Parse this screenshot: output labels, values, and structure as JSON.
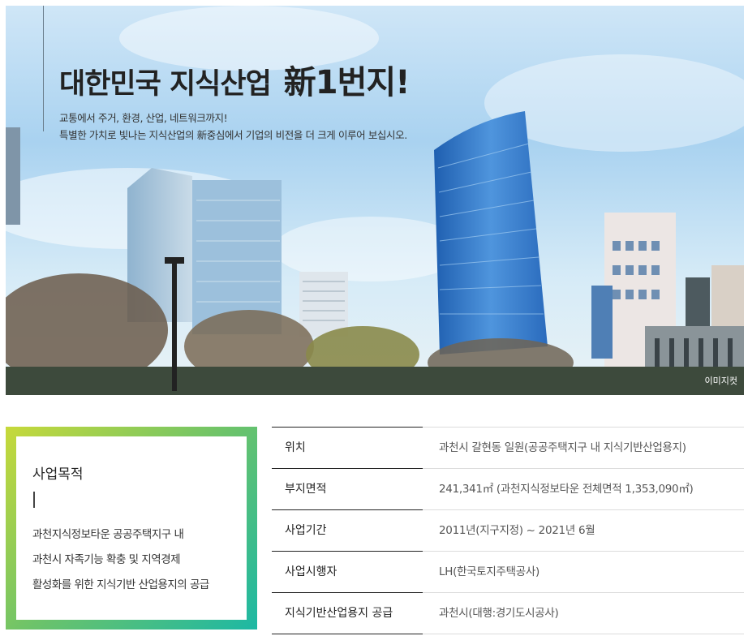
{
  "hero": {
    "title_main": "대한민국 지식산업",
    "title_accent": "新1번지!",
    "subtitle_line1": "교통에서 주거, 환경, 산업, 네트워크까지!",
    "subtitle_line2": "특별한 가치로 빛나는 지식산업의 新중심에서 기업의 비전을 더 크게 이루어 보십시오.",
    "image_credit": "이미지컷"
  },
  "purpose": {
    "title": "사업목적",
    "line1": "과천지식정보타운 공공주택지구 내",
    "line2": "과천시 자족기능 확충 및 지역경제",
    "line3": "활성화를 위한 지식기반 산업용지의 공급",
    "gradient_colors": [
      "#c7d93a",
      "#6cc36a",
      "#1cb8a4"
    ]
  },
  "info_rows": [
    {
      "label": "위치",
      "value": "과천시 갈현동 일원(공공주택지구 내 지식기반산업용지)"
    },
    {
      "label": "부지면적",
      "value": "241,341㎡ (과천지식정보타운 전체면적 1,353,090㎡)"
    },
    {
      "label": "사업기간",
      "value": "2011년(지구지정) ~ 2021년 6월"
    },
    {
      "label": "사업시행자",
      "value": "LH(한국토지주택공사)"
    },
    {
      "label": "지식기반산업용지 공급",
      "value": "과천시(대행:경기도시공사)"
    }
  ]
}
